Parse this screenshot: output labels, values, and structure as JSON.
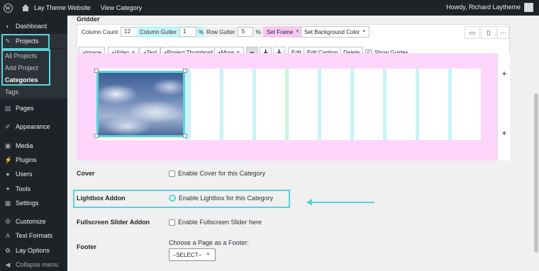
{
  "adminbar": {
    "site_name": "Lay Theme Website",
    "view_link": "View Category",
    "howdy": "Howdy, Richard Laytheme"
  },
  "sidebar": {
    "items": [
      {
        "label": "Dashboard",
        "icon": "dashboard-icon"
      },
      {
        "label": "Projects",
        "icon": "pin-icon"
      },
      {
        "label": "Pages",
        "icon": "pages-icon"
      },
      {
        "label": "Appearance",
        "icon": "brush-icon"
      },
      {
        "label": "Media",
        "icon": "media-icon"
      },
      {
        "label": "Plugins",
        "icon": "plugin-icon"
      },
      {
        "label": "Users",
        "icon": "users-icon"
      },
      {
        "label": "Tools",
        "icon": "wrench-icon"
      },
      {
        "label": "Settings",
        "icon": "settings-icon"
      },
      {
        "label": "Customize",
        "icon": "customize-icon"
      },
      {
        "label": "Text Formats",
        "icon": "text-icon"
      },
      {
        "label": "Lay Options",
        "icon": "gear-icon"
      },
      {
        "label": "Collapse menu",
        "icon": "collapse-icon"
      }
    ],
    "submenu": [
      "All Projects",
      "Add Project",
      "Categories",
      "Tags"
    ]
  },
  "gridder": {
    "title": "Gridder",
    "column_count_label": "Column Count",
    "column_count": "12",
    "column_gutter_label": "Column Gutter",
    "column_gutter": "1",
    "row_gutter_label": "Row Gutter",
    "row_gutter": "5",
    "percent": "%",
    "set_frame": "Set Frame",
    "set_background": "Set Background Color",
    "buttons": {
      "image": "+Image",
      "video": "+Video",
      "text": "+Text",
      "project_thumbnail": "+Project Thumbnail",
      "more": "+More",
      "edit": "Edit",
      "edit_caption": "Edit Caption",
      "delete": "Delete",
      "show_guides": "Show Guides"
    },
    "plus": "+"
  },
  "fields": {
    "cover_label": "Cover",
    "cover_option": "Enable Cover for this Category",
    "lightbox_label": "Lightbox Addon",
    "lightbox_option": "Enable Lightbox for this Category",
    "fullscreen_label": "Fullscreen Slider Addon",
    "fullscreen_option": "Enable Fullscreen Slider here",
    "footer_label": "Footer",
    "footer_hint": "Choose a Page as a Footer:",
    "footer_select": "--SELECT--"
  },
  "colors": {
    "highlight": "#5ad2d9",
    "grid_background": "#ffd6fb",
    "gutter": "#c8f3f7"
  }
}
